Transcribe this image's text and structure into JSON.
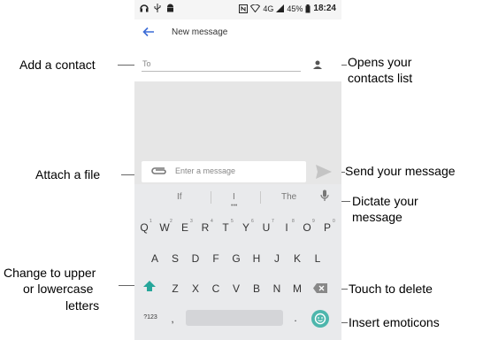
{
  "status_bar": {
    "icons": [
      "headset-icon",
      "usb-icon",
      "android-icon",
      "nfc-icon",
      "wifi-icon",
      "signal-icon",
      "battery-icon"
    ],
    "network": "4G",
    "battery": "45%",
    "time": "18:24"
  },
  "toolbar": {
    "title": "New message"
  },
  "to_field": {
    "placeholder": "To"
  },
  "compose": {
    "placeholder": "Enter a message"
  },
  "keyboard": {
    "suggestions": [
      "If",
      "I",
      "The"
    ],
    "row1": [
      "Q",
      "W",
      "E",
      "R",
      "T",
      "Y",
      "U",
      "I",
      "O",
      "P"
    ],
    "row1_hints": [
      "1",
      "2",
      "3",
      "4",
      "5",
      "6",
      "7",
      "8",
      "9",
      "0"
    ],
    "row2": [
      "A",
      "S",
      "D",
      "F",
      "G",
      "H",
      "J",
      "K",
      "L"
    ],
    "row3": [
      "Z",
      "X",
      "C",
      "V",
      "B",
      "N",
      "M"
    ],
    "symbols_key": "?123",
    "comma": ",",
    "period": "."
  },
  "callouts": {
    "add_contact": "Add  a  contact",
    "contacts_list_1": "Opens your",
    "contacts_list_2": "contacts list",
    "attach": "Attach  a  file",
    "send": "Send your message",
    "dictate_1": "Dictate your",
    "dictate_2": "message",
    "case_1": "Change to upper",
    "case_2": "or lowercase",
    "case_3": "letters",
    "delete": "Touch to delete",
    "emoticons": "Insert emoticons"
  }
}
